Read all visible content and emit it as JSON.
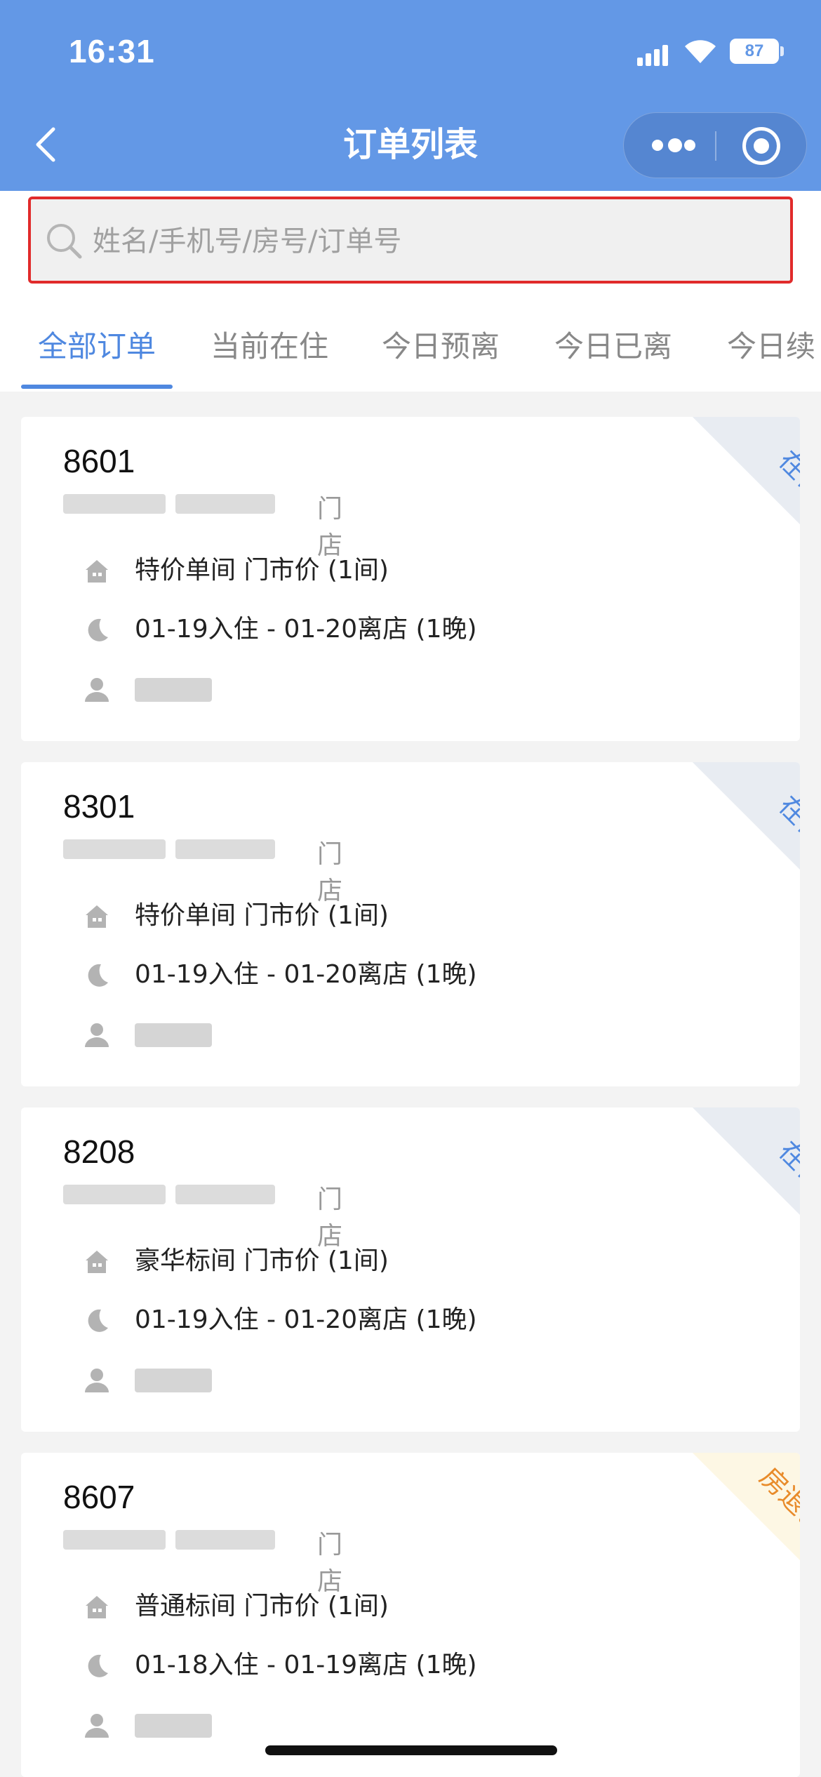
{
  "status_bar": {
    "time": "16:31",
    "battery": "87"
  },
  "nav": {
    "title": "订单列表"
  },
  "search": {
    "placeholder": "姓名/手机号/房号/订单号"
  },
  "tabs": [
    {
      "label": "全部订单",
      "active": true
    },
    {
      "label": "当前在住",
      "active": false
    },
    {
      "label": "今日预离",
      "active": false
    },
    {
      "label": "今日已离",
      "active": false
    },
    {
      "label": "今日续",
      "active": false
    }
  ],
  "orders": [
    {
      "room": "8601",
      "store_suffix": "门店",
      "room_type": "特价单间 门市价 (1间)",
      "dates": "01-19入住 - 01-20离店 (1晚)",
      "status": "在住",
      "status_color": "#4f88e0"
    },
    {
      "room": "8301",
      "store_suffix": "门店",
      "room_type": "特价单间 门市价 (1间)",
      "dates": "01-19入住 - 01-20离店 (1晚)",
      "status": "在住",
      "status_color": "#4f88e0"
    },
    {
      "room": "8208",
      "store_suffix": "门店",
      "room_type": "豪华标间 门市价 (1间)",
      "dates": "01-19入住 - 01-20离店 (1晚)",
      "status": "在住",
      "status_color": "#4f88e0"
    },
    {
      "room": "8607",
      "store_suffix": "门店",
      "room_type": "普通标间 门市价 (1间)",
      "dates": "01-18入住 - 01-19离店 (1晚)",
      "status": "房退已结",
      "status_color": "#e88b2a"
    }
  ],
  "colors": {
    "header": "#6398e6",
    "accent": "#4f88e0",
    "highlight_border": "#e12b2b"
  }
}
